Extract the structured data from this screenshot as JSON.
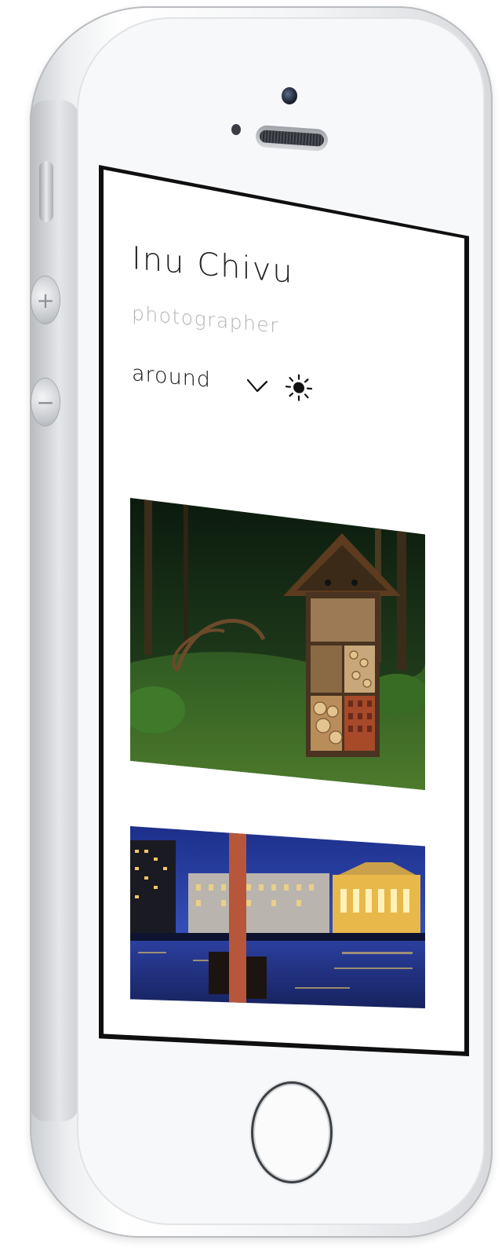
{
  "site": {
    "title": "Inu Chivu",
    "subtitle": "photographer"
  },
  "nav": {
    "menu_label": "around",
    "menu_icon": "chevron-down-icon",
    "theme_icon": "sun-icon"
  },
  "gallery": {
    "items": [
      {
        "name": "photo-insect-hotel"
      },
      {
        "name": "photo-night-riverside"
      }
    ]
  },
  "device": {
    "frame_color": "#f7f8fa",
    "screen_bezel_color": "#0f0f10"
  }
}
